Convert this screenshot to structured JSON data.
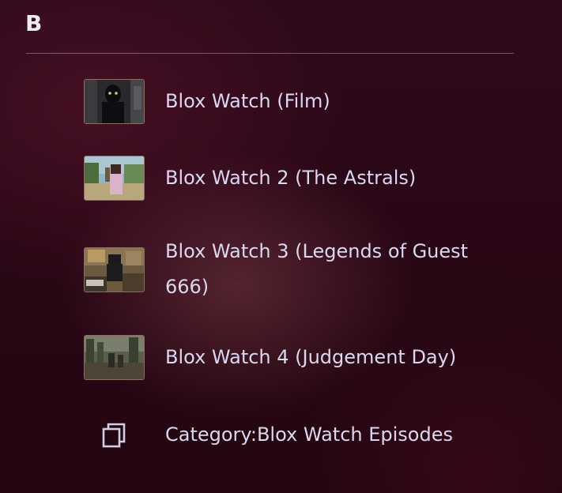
{
  "section": {
    "letter": "B"
  },
  "entries": [
    {
      "label": "Blox Watch (Film)",
      "thumbnail": "dark-figure-thumbnail"
    },
    {
      "label": "Blox Watch 2 (The Astrals)",
      "thumbnail": "outdoor-scene-thumbnail"
    },
    {
      "label": "Blox Watch 3 (Legends of Guest 666)",
      "thumbnail": "room-scene-thumbnail"
    },
    {
      "label": "Blox Watch 4 (Judgement Day)",
      "thumbnail": "forest-scene-thumbnail"
    }
  ],
  "category": {
    "label": "Category:Blox Watch Episodes",
    "icon": "copy-pages-icon"
  }
}
